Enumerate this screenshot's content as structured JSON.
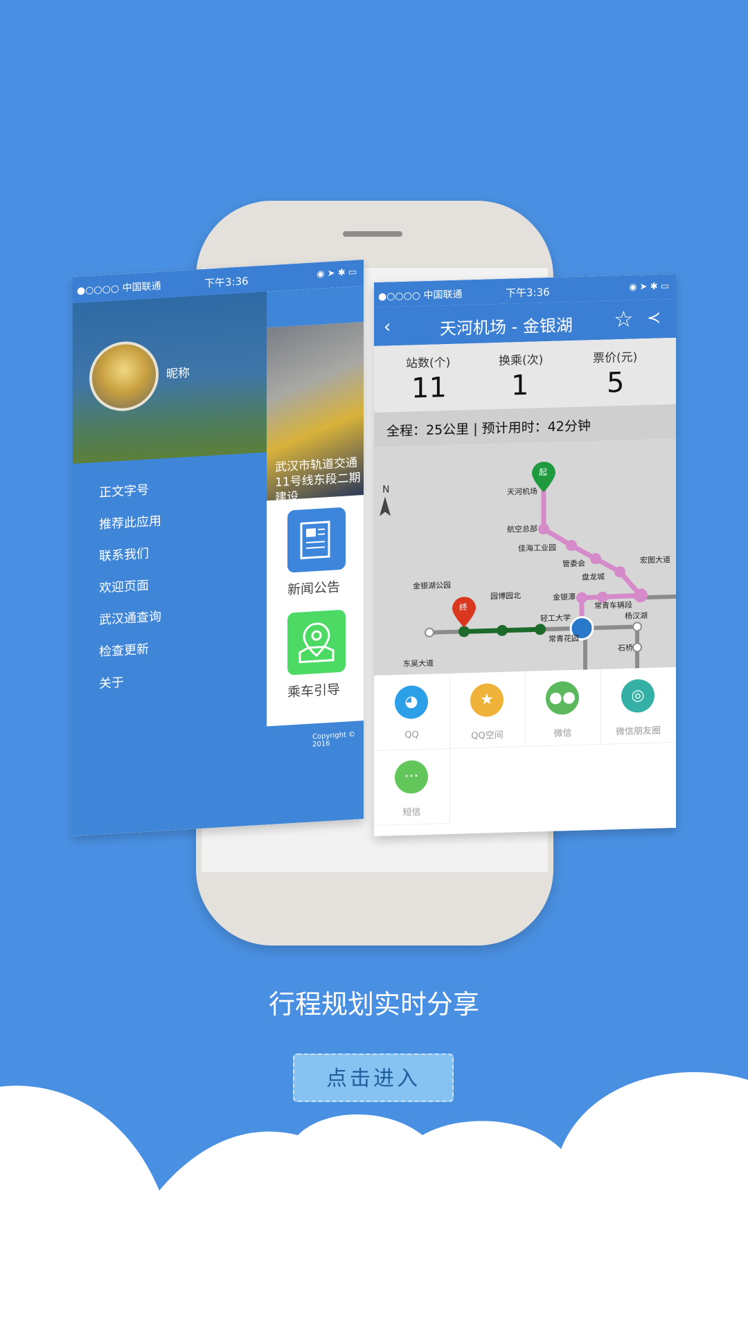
{
  "left_screen": {
    "status": {
      "carrier": "●○○○○ 中国联通",
      "time": "下午3:36"
    },
    "drawer": {
      "nickname": "昵称",
      "menu": [
        "正文字号",
        "推荐此应用",
        "联系我们",
        "欢迎页面",
        "武汉通查询",
        "检查更新",
        "关于"
      ]
    },
    "main": {
      "news_caption": "武汉市轨道交通11号线东段二期建设",
      "tiles": [
        {
          "label": "新闻公告",
          "color": "#3d86dc",
          "icon": "newspaper-icon"
        },
        {
          "label": "乘车引导",
          "color": "#4cd964",
          "icon": "map-pin-icon"
        }
      ],
      "copyright": "Copyright © 2016"
    }
  },
  "right_screen": {
    "status": {
      "carrier": "●○○○○ 中国联通",
      "time": "下午3:36"
    },
    "title": "天河机场 - 金银湖",
    "stats": [
      {
        "label": "站数(个)",
        "value": "11"
      },
      {
        "label": "换乘(次)",
        "value": "1"
      },
      {
        "label": "票价(元)",
        "value": "5"
      }
    ],
    "summary": "全程：25公里 | 预计用时：42分钟",
    "map": {
      "compass": "N",
      "start_marker": "起",
      "end_marker": "终",
      "stations": [
        "天河机场",
        "航空总部",
        "佳海工业园",
        "管委会",
        "盘龙城",
        "宏图大道",
        "金银潭",
        "常青车辆段",
        "轻工大学",
        "常青花园",
        "杨汉湖",
        "石桥",
        "园博园北",
        "金银湖公园",
        "东吴大道"
      ]
    },
    "share": [
      {
        "label": "QQ",
        "icon": "qq-icon",
        "color": "#2ba0e8"
      },
      {
        "label": "QQ空间",
        "icon": "qzone-icon",
        "color": "#f0b33a"
      },
      {
        "label": "微信",
        "icon": "wechat-icon",
        "color": "#5cb85c"
      },
      {
        "label": "微信朋友圈",
        "icon": "moments-icon",
        "color": "#35b0a4"
      },
      {
        "label": "短信",
        "icon": "sms-icon",
        "color": "#63c65a"
      }
    ]
  },
  "tagline": "行程规划实时分享",
  "enter_button": "点击进入"
}
